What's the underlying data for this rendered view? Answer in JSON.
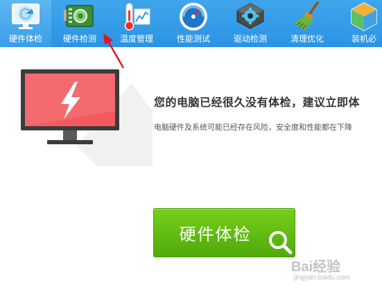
{
  "toolbar": {
    "items": [
      {
        "label": "硬件体检",
        "icon": "monitor-radar-icon",
        "active": true
      },
      {
        "label": "硬件检测",
        "icon": "motherboard-icon",
        "active": false
      },
      {
        "label": "温度管理",
        "icon": "thermometer-icon",
        "active": false
      },
      {
        "label": "性能测试",
        "icon": "speedometer-icon",
        "active": false
      },
      {
        "label": "驱动检测",
        "icon": "driver-gear-icon",
        "active": false
      },
      {
        "label": "清理优化",
        "icon": "broom-icon",
        "active": false
      },
      {
        "label": "装机必",
        "icon": "cube-box-icon",
        "active": false
      }
    ]
  },
  "hero": {
    "headline": "您的电脑已经很久没有体检，建议立即体",
    "subline": "电脑硬件及系统可能已经存在风险，安全度和性能都在下降"
  },
  "main_button": {
    "label": "硬件体检"
  },
  "watermark": {
    "brand": "Bai经验",
    "url": "jingyan.baidu.com"
  },
  "colors": {
    "toolbar_bg": "#2b93e4",
    "button_green": "#5fb912",
    "monitor_red": "#f2575b",
    "annotation_arrow": "#e8141c"
  }
}
